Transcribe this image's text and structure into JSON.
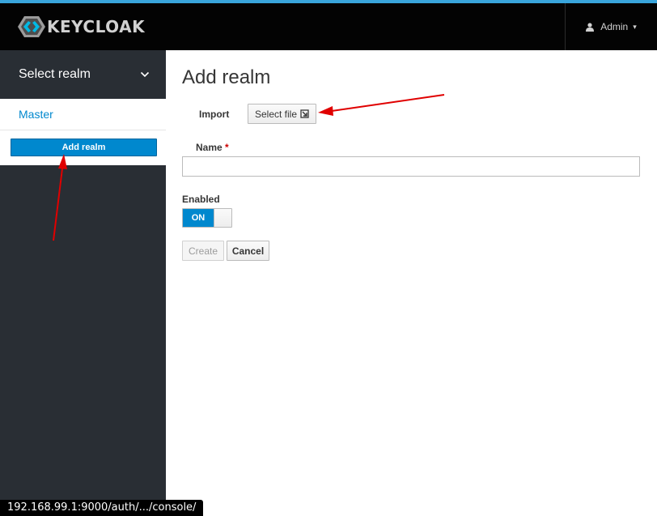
{
  "header": {
    "brand": "KEYCLOAK",
    "user": "Admin"
  },
  "sidebar": {
    "realm_selector": "Select realm",
    "realms": [
      "Master"
    ],
    "add_realm": "Add realm"
  },
  "main": {
    "title": "Add realm",
    "import_label": "Import",
    "select_file": "Select file",
    "name_label": "Name",
    "required_mark": "*",
    "name_value": "",
    "enabled_label": "Enabled",
    "toggle_state": "ON",
    "create": "Create",
    "cancel": "Cancel"
  },
  "status_bar": {
    "url": "192.168.99.1:9000/auth/.../console/"
  },
  "colors": {
    "accent": "#0088ce",
    "topbar": "#030303",
    "sidebar": "#292e34",
    "annotation": "#e00000"
  }
}
